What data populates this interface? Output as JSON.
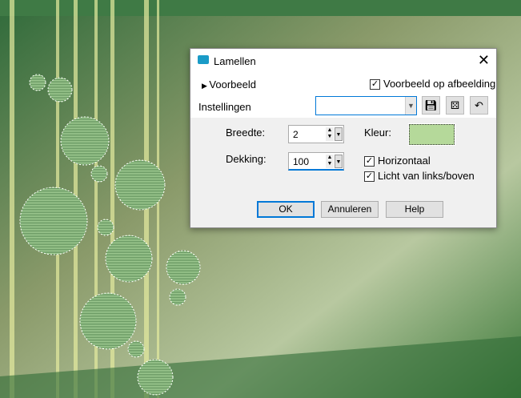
{
  "dialog": {
    "title": "Lamellen",
    "close": "✕",
    "preview_toggle": "Voorbeeld",
    "preview_on_image": "Voorbeeld op afbeelding",
    "settings_label": "Instellingen",
    "settings_value": "",
    "width_label": "Breedte:",
    "width_value": "2",
    "opacity_label": "Dekking:",
    "opacity_value": "100",
    "color_label": "Kleur:",
    "color_value": "#b5d99a",
    "horizontal": "Horizontaal",
    "light": "Licht van links/boven",
    "ok": "OK",
    "cancel": "Annuleren",
    "help": "Help"
  }
}
